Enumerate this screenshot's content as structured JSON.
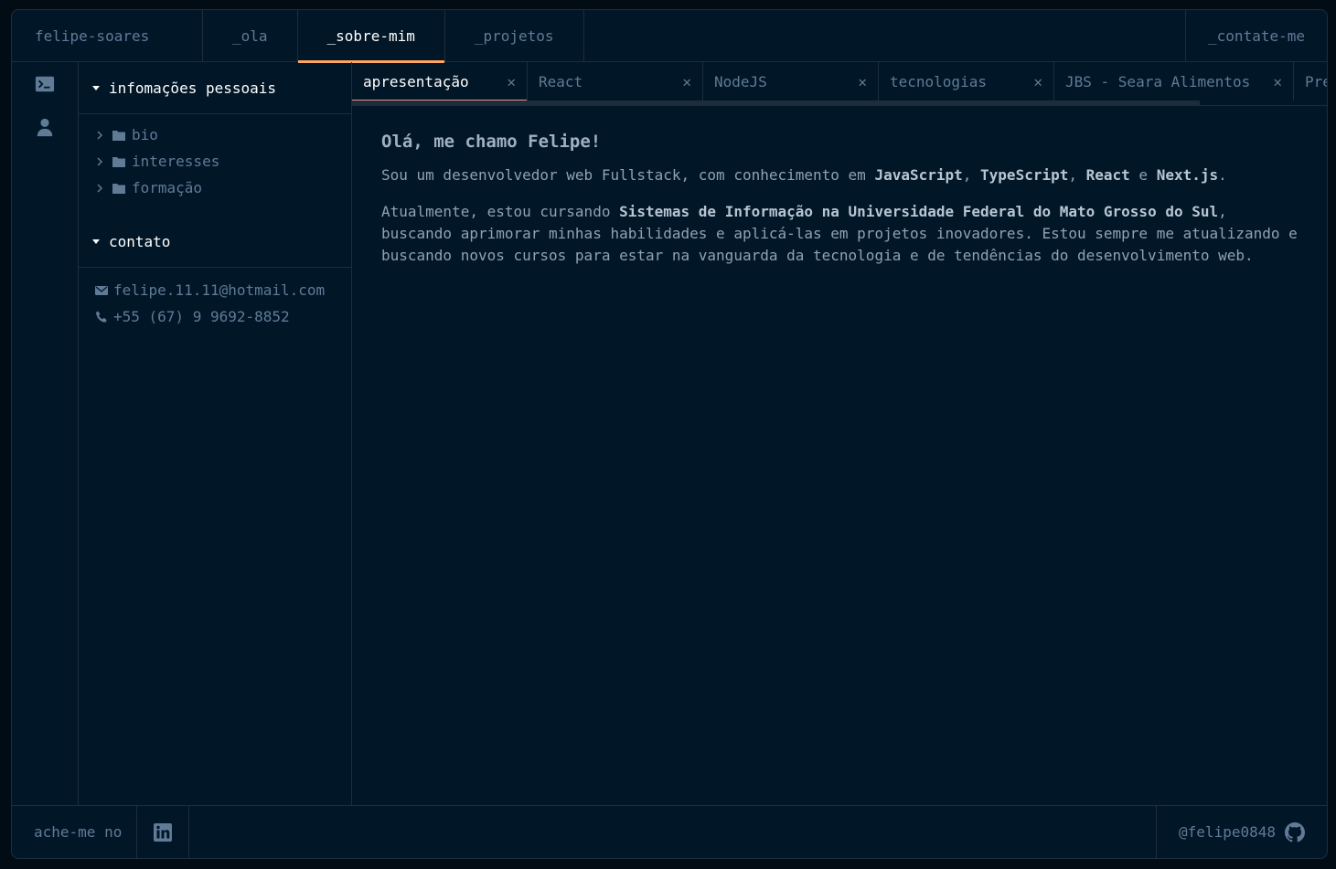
{
  "header": {
    "brand": "felipe-soares",
    "nav": [
      {
        "label": "_ola"
      },
      {
        "label": "_sobre-mim",
        "active": true
      },
      {
        "label": "_projetos"
      }
    ],
    "contact": "_contate-me"
  },
  "activity": {
    "icons": [
      "terminal-icon",
      "user-icon"
    ]
  },
  "sidebar": {
    "personal_title": "infomações pessoais",
    "folders": [
      {
        "label": "bio"
      },
      {
        "label": "interesses"
      },
      {
        "label": "formação"
      }
    ],
    "contact_title": "contato",
    "email": "felipe.11.11@hotmail.com",
    "phone": "+55 (67) 9 9692-8852"
  },
  "tabs": [
    {
      "label": "apresentação",
      "active": true
    },
    {
      "label": "React"
    },
    {
      "label": "NodeJS"
    },
    {
      "label": "tecnologias"
    },
    {
      "label": "JBS - Seara Alimentos"
    },
    {
      "label": "Pre"
    }
  ],
  "content": {
    "heading": "Olá, me chamo Felipe!",
    "p1_before": "Sou um desenvolvedor web Fullstack, com conhecimento em ",
    "p1_js": "JavaScript",
    "p1_sep1": ", ",
    "p1_ts": "TypeScript",
    "p1_sep2": ", ",
    "p1_react": "React",
    "p1_and": " e ",
    "p1_next": "Next.js",
    "p1_end": ".",
    "p2_before": "Atualmente, estou cursando ",
    "p2_bold": "Sistemas de Informação na Universidade Federal do Mato Grosso do Sul",
    "p2_after": ", buscando aprimorar minhas habilidades e aplicá-las em projetos inovadores. Estou sempre me atualizando e buscando novos cursos para estar na vanguarda da tecnologia e de tendências do desenvolvimento web."
  },
  "footer": {
    "find_me": "ache-me no",
    "social_icon": "linkedin-icon",
    "github_user": "@felipe0848",
    "github_icon": "github-icon"
  },
  "colors": {
    "background": "#011627",
    "border": "#1e2d3d",
    "accent": "#fea55f",
    "text": "#607b96",
    "tab_active_underline": "#e99287"
  }
}
